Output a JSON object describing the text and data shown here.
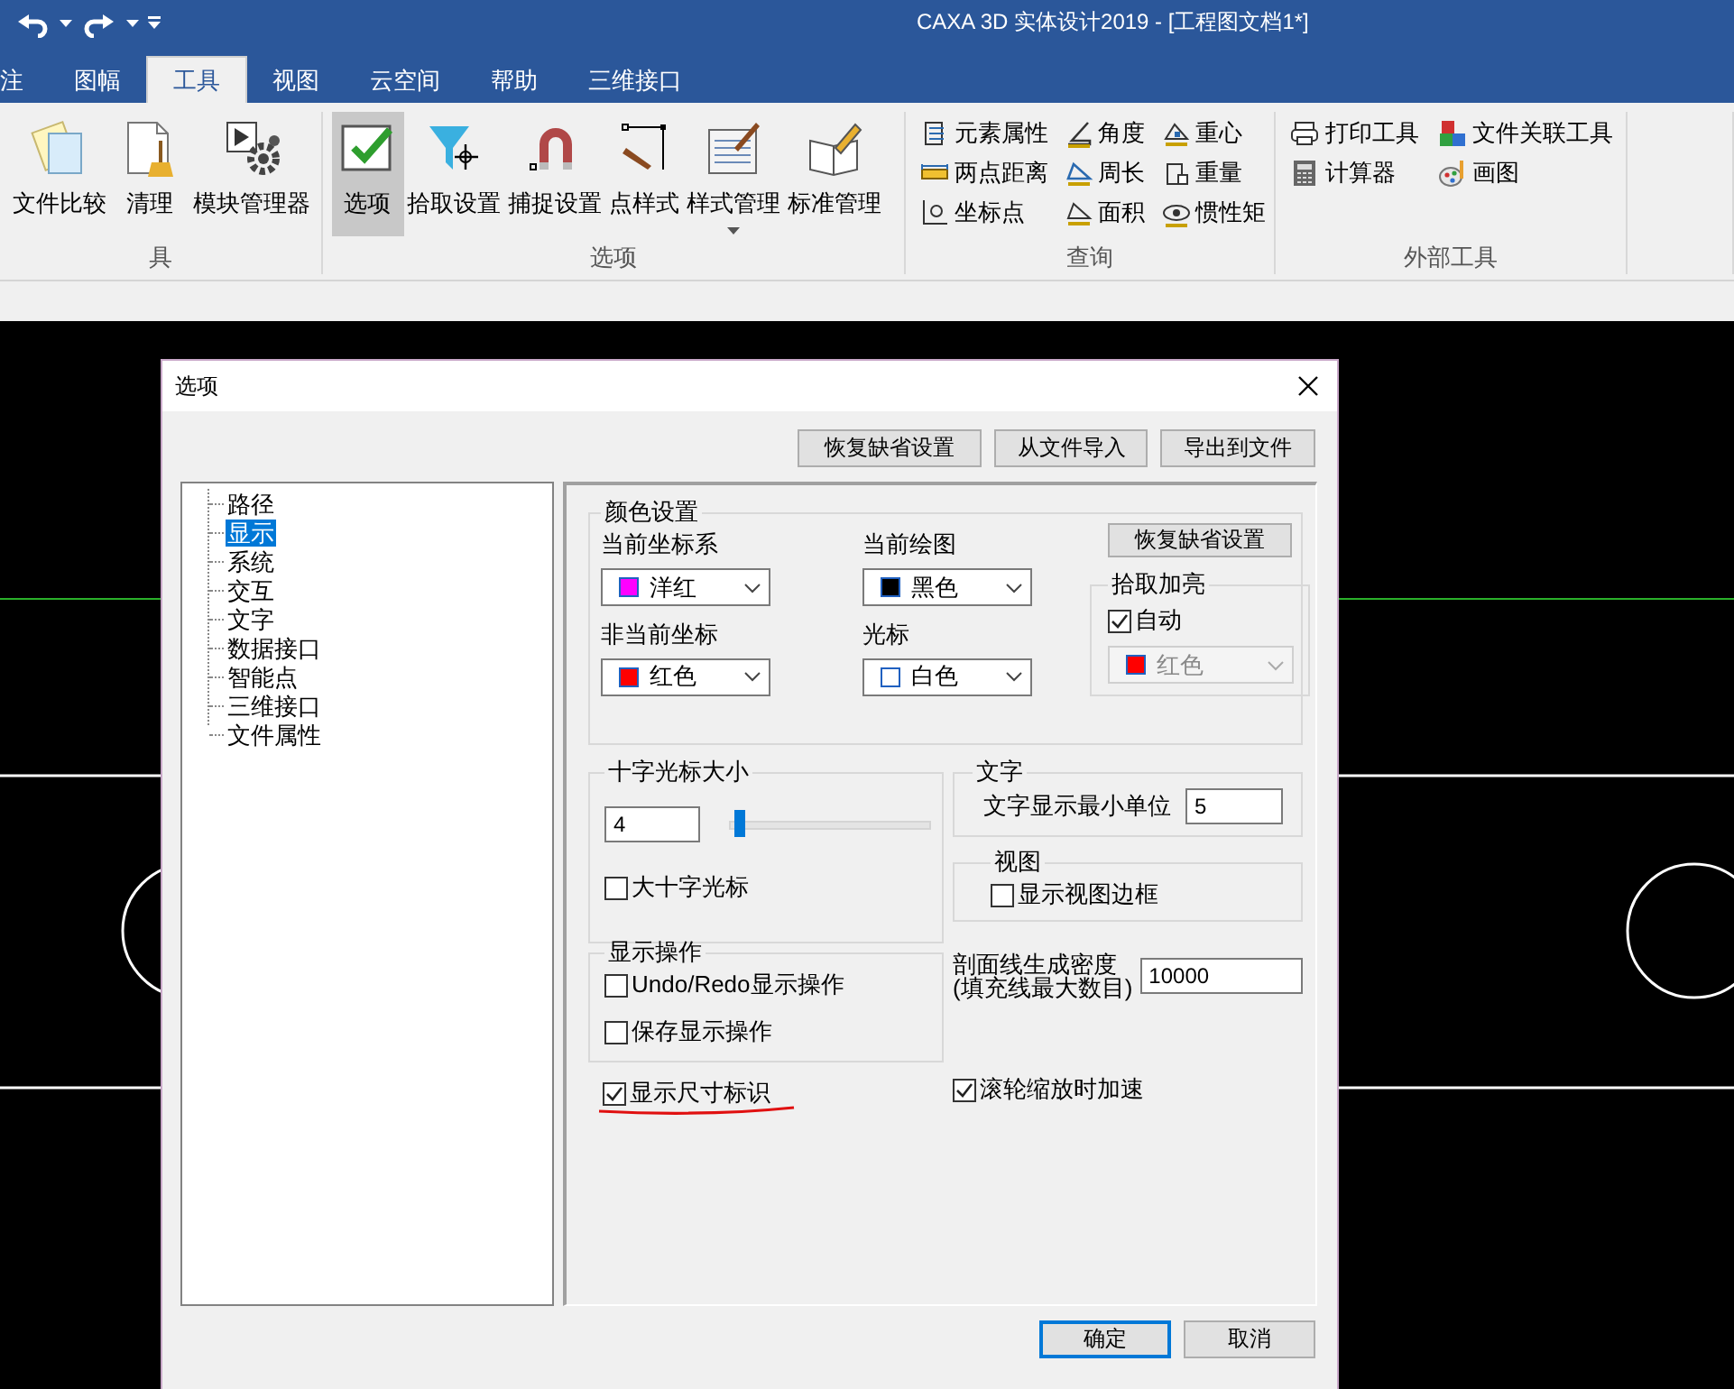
{
  "window": {
    "title": "CAXA 3D 实体设计2019 - [工程图文档1*]"
  },
  "tabs": [
    {
      "label": "注",
      "selected": false
    },
    {
      "label": "图幅",
      "selected": false
    },
    {
      "label": "工具",
      "selected": true
    },
    {
      "label": "视图",
      "selected": false
    },
    {
      "label": "云空间",
      "selected": false
    },
    {
      "label": "帮助",
      "selected": false
    },
    {
      "label": "三维接口",
      "selected": false
    }
  ],
  "ribbon_groups": [
    {
      "label": "具",
      "kind": "large",
      "items": [
        {
          "label": "文件比较",
          "selected": false
        },
        {
          "label": "清理",
          "selected": false
        },
        {
          "label": "模块管理器",
          "selected": false
        }
      ]
    },
    {
      "label": "选项",
      "kind": "large",
      "items": [
        {
          "label": "选项",
          "selected": true
        },
        {
          "label": "拾取设置",
          "selected": false
        },
        {
          "label": "捕捉设置",
          "selected": false
        },
        {
          "label": "点样式",
          "selected": false
        },
        {
          "label": "样式管理",
          "selected": false,
          "dropdown": true
        },
        {
          "label": "标准管理",
          "selected": false
        }
      ]
    },
    {
      "label": "查询",
      "kind": "small",
      "items": [
        {
          "label": "元素属性"
        },
        {
          "label": "角度"
        },
        {
          "label": "重心"
        },
        {
          "label": "两点距离"
        },
        {
          "label": "周长"
        },
        {
          "label": "重量"
        },
        {
          "label": "坐标点"
        },
        {
          "label": "面积"
        },
        {
          "label": "惯性矩"
        }
      ]
    },
    {
      "label": "外部工具",
      "kind": "small",
      "items": [
        {
          "label": "打印工具"
        },
        {
          "label": "文件关联工具"
        },
        {
          "label": "计算器"
        },
        {
          "label": "画图"
        }
      ]
    }
  ],
  "dialog": {
    "title": "选项",
    "top_buttons": [
      "恢复缺省设置",
      "从文件导入",
      "导出到文件"
    ],
    "tree": [
      {
        "label": "路径",
        "selected": false
      },
      {
        "label": "显示",
        "selected": true
      },
      {
        "label": "系统",
        "selected": false
      },
      {
        "label": "交互",
        "selected": false
      },
      {
        "label": "文字",
        "selected": false
      },
      {
        "label": "数据接口",
        "selected": false
      },
      {
        "label": "智能点",
        "selected": false
      },
      {
        "label": "三维接口",
        "selected": false
      },
      {
        "label": "文件属性",
        "selected": false
      }
    ],
    "color_group": {
      "title": "颜色设置",
      "reset_button": "恢复缺省设置",
      "fields": [
        {
          "label": "当前坐标系",
          "value": "洋红",
          "color": "#ff00ff"
        },
        {
          "label": "当前绘图",
          "value": "黑色",
          "color": "#000000"
        },
        {
          "label": "非当前坐标",
          "value": "红色",
          "color": "#ff0000"
        },
        {
          "label": "光标",
          "value": "白色",
          "color": "#ffffff"
        }
      ],
      "highlight": {
        "title": "拾取加亮",
        "auto": {
          "label": "自动",
          "checked": true
        },
        "value": "红色",
        "color": "#ff0000",
        "disabled": true
      }
    },
    "crosshair": {
      "title": "十字光标大小",
      "value": "4",
      "level": 0.02,
      "large": {
        "label": "大十字光标",
        "checked": false
      }
    },
    "text_group": {
      "title": "文字",
      "label": "文字显示最小单位",
      "value": "5"
    },
    "view_group": {
      "title": "视图",
      "option": {
        "label": "显示视图边框",
        "checked": false
      }
    },
    "display_ops": {
      "title": "显示操作",
      "options": [
        {
          "label": "Undo/Redo显示操作",
          "checked": false
        },
        {
          "label": "保存显示操作",
          "checked": false
        }
      ]
    },
    "hatch": {
      "label": "剖面线生成密度\n(填充线最大数目)",
      "value": "10000"
    },
    "options": [
      {
        "label": "显示尺寸标识",
        "checked": true
      },
      {
        "label": "滚轮缩放时加速",
        "checked": true
      }
    ],
    "buttons": [
      {
        "label": "确定",
        "kind": "default"
      },
      {
        "label": "取消",
        "kind": "normal"
      }
    ]
  }
}
